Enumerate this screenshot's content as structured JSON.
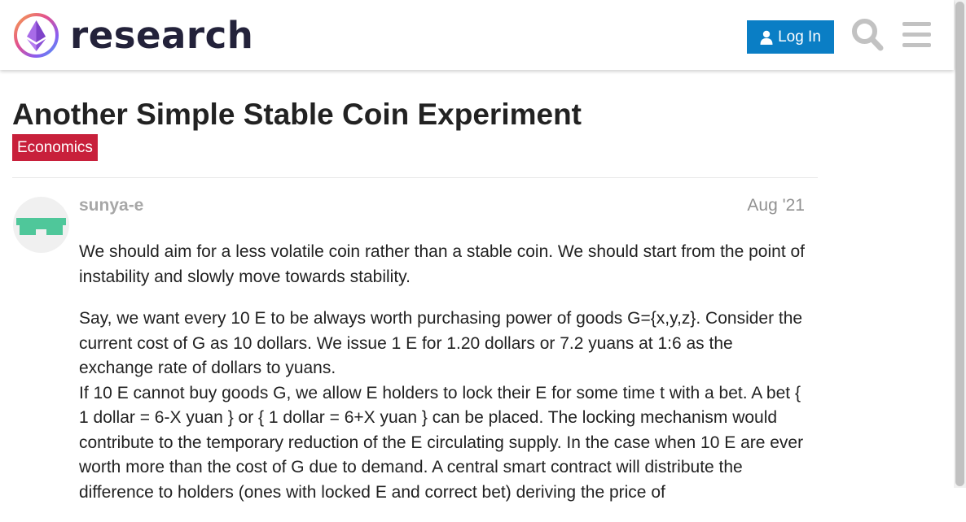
{
  "header": {
    "site_name": "research",
    "login_label": "Log In",
    "search_icon": "search-icon",
    "menu_icon": "hamburger-menu-icon",
    "colors": {
      "login_button": "#0a7ec5",
      "logo_text": "#23223a"
    }
  },
  "topic": {
    "title": "Another Simple Stable Coin Experiment",
    "category": "Economics",
    "category_color": "#c8203b"
  },
  "post": {
    "username": "sunya-e",
    "date": "Aug '21",
    "avatar_icon": "identicon-avatar",
    "avatar_color": "#4fc79a",
    "paragraphs": [
      "We should aim for a less volatile coin rather than a stable coin. We should start from the point of instability and slowly move towards stability.",
      "Say, we want every 10 E to be always worth purchasing power of goods G={x,y,z}. Consider the current cost of G as 10 dollars. We issue 1 E for 1.20 dollars or 7.2 yuans at 1:6 as the exchange rate of dollars to yuans.\nIf 10 E cannot buy goods G, we allow E holders to lock their E for some time t with a bet. A bet { 1 dollar = 6-X yuan } or { 1 dollar = 6+X yuan } can be placed. The locking mechanism would contribute to the temporary reduction of the E circulating supply. In the case when 10 E are ever worth more than the cost of G due to demand. A central smart contract will distribute the difference to holders (ones with locked E and correct bet) deriving the price of"
    ]
  }
}
